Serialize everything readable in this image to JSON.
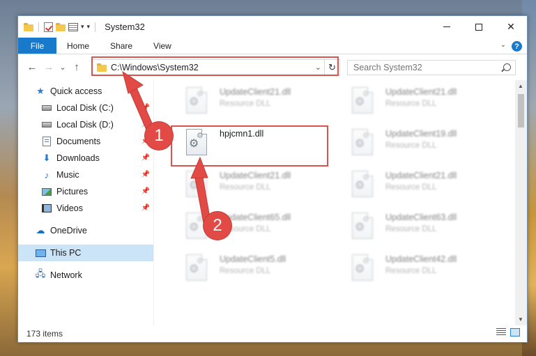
{
  "window": {
    "title": "System32",
    "dropdown_arrow": "▾"
  },
  "ribbon": {
    "tabs": [
      "File",
      "Home",
      "Share",
      "View"
    ],
    "help": "?"
  },
  "navigation": {
    "back": "←",
    "forward": "→",
    "recent": "⌄",
    "up": "↑",
    "address": "C:\\Windows\\System32",
    "search_placeholder": "Search System32"
  },
  "sidebar": {
    "items": [
      {
        "label": "Quick access",
        "icon": "star-icon",
        "pinned": false
      },
      {
        "label": "Local Disk (C:)",
        "icon": "drive-icon",
        "pinned": true
      },
      {
        "label": "Local Disk (D:)",
        "icon": "drive-icon",
        "pinned": true
      },
      {
        "label": "Documents",
        "icon": "document-icon",
        "pinned": true
      },
      {
        "label": "Downloads",
        "icon": "download-icon",
        "pinned": true
      },
      {
        "label": "Music",
        "icon": "music-icon",
        "pinned": true
      },
      {
        "label": "Pictures",
        "icon": "pictures-icon",
        "pinned": true
      },
      {
        "label": "Videos",
        "icon": "videos-icon",
        "pinned": true
      },
      {
        "label": "OneDrive",
        "icon": "cloud-icon"
      },
      {
        "label": "This PC",
        "icon": "computer-icon",
        "selected": true
      },
      {
        "label": "Network",
        "icon": "network-icon"
      }
    ]
  },
  "files": [
    {
      "name": "UpdateClient21.dll",
      "type": "Resource DLL",
      "blurred": true
    },
    {
      "name": "UpdateClient21.dll",
      "type": "Resource DLL",
      "blurred": true
    },
    {
      "name": "hpjcmn1.dll",
      "type": "",
      "blurred": false
    },
    {
      "name": "UpdateClient19.dll",
      "type": "Resource DLL",
      "blurred": true
    },
    {
      "name": "UpdateClient21.dll",
      "type": "Resource DLL",
      "blurred": true
    },
    {
      "name": "UpdateClient21.dll",
      "type": "Resource DLL",
      "blurred": true
    },
    {
      "name": "UpdateClient65.dll",
      "type": "Resource DLL",
      "blurred": true
    },
    {
      "name": "UpdateClient63.dll",
      "type": "Resource DLL",
      "blurred": true
    },
    {
      "name": "UpdateClient5.dll",
      "type": "Resource DLL",
      "blurred": true
    },
    {
      "name": "UpdateClient42.dll",
      "type": "Resource DLL",
      "blurred": true
    }
  ],
  "status": {
    "item_count": "173 items"
  },
  "annotations": {
    "step1": "1",
    "step2": "2",
    "color": "#e24a45"
  }
}
